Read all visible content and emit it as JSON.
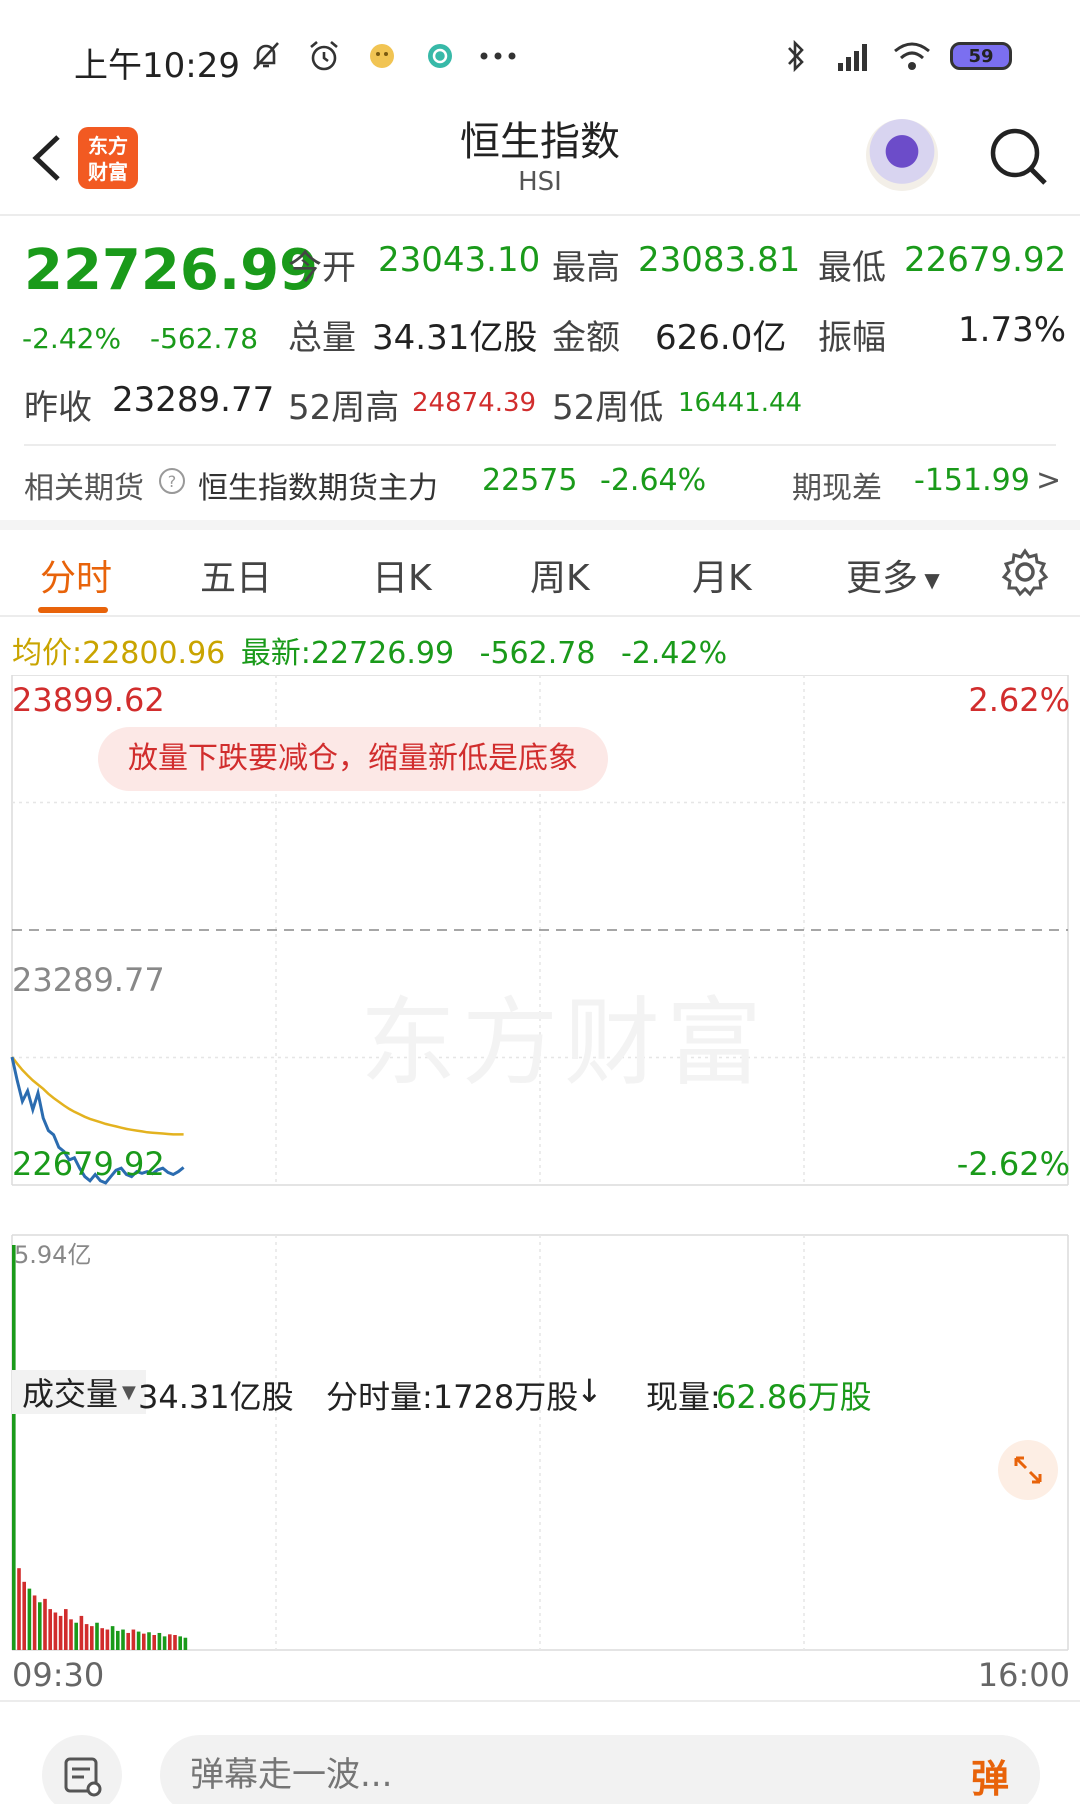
{
  "status_bar": {
    "time": "上午10:29",
    "battery": "59"
  },
  "nav": {
    "title": "恒生指数",
    "subtitle": "HSI",
    "logo_text": "东方财富"
  },
  "quote": {
    "price": "22726.99",
    "change_pct": "-2.42%",
    "change_abs": "-562.78",
    "open_label": "今开",
    "open": "23043.10",
    "high_label": "最高",
    "high": "23083.81",
    "low_label": "最低",
    "low": "22679.92",
    "volume_label": "总量",
    "volume": "34.31亿股",
    "amount_label": "金额",
    "amount": "626.0亿",
    "amplitude_label": "振幅",
    "amplitude": "1.73%",
    "prev_close_label": "昨收",
    "prev_close": "23289.77",
    "week52_high_label": "52周高",
    "week52_high": "24874.39",
    "week52_low_label": "52周低",
    "week52_low": "16441.44"
  },
  "futures": {
    "label": "相关期货",
    "name": "恒生指数期货主力",
    "price": "22575",
    "change_pct": "-2.64%",
    "basis_label": "期现差",
    "basis": "-151.99",
    "arrow": ">"
  },
  "tabs": [
    {
      "label": "分时",
      "active": true
    },
    {
      "label": "五日",
      "active": false
    },
    {
      "label": "日K",
      "active": false
    },
    {
      "label": "周K",
      "active": false
    },
    {
      "label": "月K",
      "active": false
    },
    {
      "label": "更多",
      "active": false
    }
  ],
  "avg_row": {
    "avg_label": "均价:",
    "avg": "22800.96",
    "latest_label": "最新:",
    "latest": "22726.99",
    "change_abs": "-562.78",
    "change_pct": "-2.42%"
  },
  "chart": {
    "tip": "放量下跌要减仓，缩量新低是底象",
    "watermark": "东方财富",
    "y_top": "23899.62",
    "y_mid": "23289.77",
    "y_bottom": "22679.92",
    "pct_top": "2.62%",
    "pct_bottom": "-2.62%",
    "x_start": "09:30",
    "x_end": "16:00",
    "volume_max_label": "5.94亿",
    "price_color": "#2b6cb0",
    "avg_color": "#e3b21f",
    "vol_up_color": "#1a9a1a",
    "vol_down_color": "#d12d2d"
  },
  "chart_data": {
    "type": "line",
    "ylim": [
      22679.92,
      23899.62
    ],
    "reference": 23289.77,
    "x_domain": [
      "09:30",
      "16:00"
    ],
    "series": [
      {
        "name": "最新",
        "values": [
          22986,
          22930,
          22880,
          22905,
          22860,
          22900,
          22840,
          22810,
          22800,
          22770,
          22760,
          22740,
          22745,
          22720,
          22700,
          22690,
          22705,
          22690,
          22685,
          22700,
          22715,
          22720,
          22705,
          22700,
          22712,
          22708,
          22712,
          22707,
          22716,
          22720,
          22710,
          22705,
          22712,
          22722
        ]
      },
      {
        "name": "均价",
        "values": [
          22986,
          22970,
          22955,
          22942,
          22930,
          22920,
          22910,
          22898,
          22888,
          22879,
          22870,
          22862,
          22855,
          22849,
          22843,
          22838,
          22834,
          22830,
          22826,
          22823,
          22820,
          22817,
          22814,
          22812,
          22810,
          22808,
          22806,
          22805,
          22804,
          22803,
          22802,
          22801,
          22801,
          22801
        ]
      }
    ],
    "volume": {
      "ylim": [
        0,
        5.94
      ],
      "unit": "亿",
      "values": [
        5.94,
        1.2,
        1.0,
        0.9,
        0.8,
        0.7,
        0.75,
        0.6,
        0.55,
        0.5,
        0.6,
        0.45,
        0.4,
        0.5,
        0.38,
        0.35,
        0.4,
        0.32,
        0.3,
        0.35,
        0.28,
        0.3,
        0.25,
        0.3,
        0.27,
        0.24,
        0.26,
        0.22,
        0.25,
        0.2,
        0.23,
        0.22,
        0.2,
        0.18
      ]
    }
  },
  "volume_row": {
    "selector_label": "成交量",
    "total": "34.31亿股",
    "minute_volume": "分时量:1728万股",
    "minute_arrow": "↓",
    "current_label": "现量:",
    "current_value": "62.86万股"
  },
  "bottom_bar": {
    "danmu_placeholder": "弹幕走一波...",
    "danmu_toggle": "弹"
  }
}
